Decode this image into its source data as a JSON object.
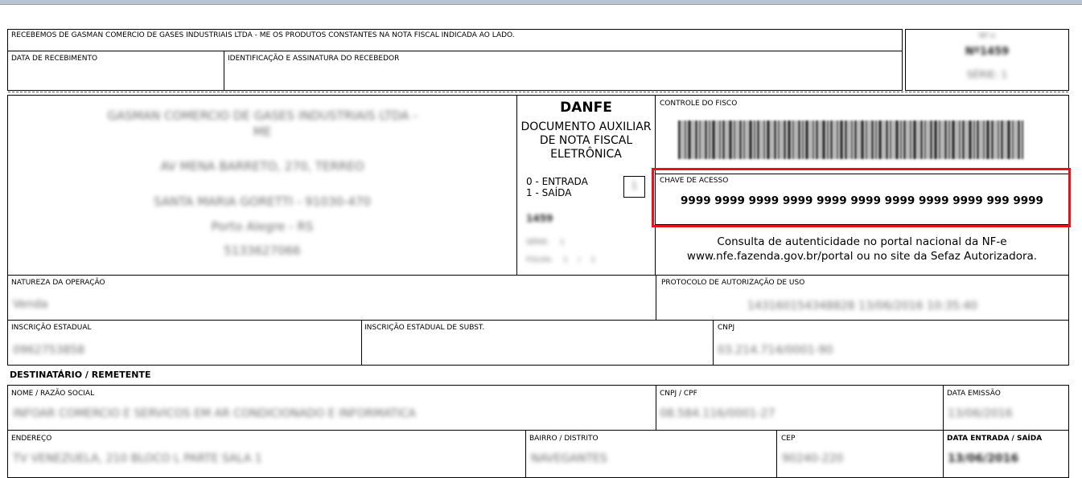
{
  "receipt": {
    "header": "RECEBEMOS DE GASMAN COMERCIO DE GASES INDUSTRIAIS LTDA - ME OS PRODUTOS CONSTANTES NA NOTA FISCAL INDICADA AO LADO.",
    "date_label": "DATA DE RECEBIMENTO",
    "signature_label": "IDENTIFICAÇÃO E ASSINATURA DO RECEBEDOR",
    "nfe_label": "NF-e",
    "nfe_number": "Nº1459",
    "nfe_series": "SÉRIE: 1"
  },
  "emitter": {
    "name_line1": "GASMAN COMERCIO DE GASES INDUSTRIAIS LTDA -",
    "name_line2": "ME",
    "address": "AV MENA BARRETO, 270, TERREO",
    "district": "SANTA MARIA GORETTI - 91030-470",
    "city": "Porto Alegre - RS",
    "phone": "5133627066"
  },
  "danfe": {
    "title": "DANFE",
    "subtitle_line1": "DOCUMENTO AUXILIAR",
    "subtitle_line2": "DE NOTA FISCAL",
    "subtitle_line3": "ELETRÔNICA",
    "entry_label": "0 - ENTRADA",
    "exit_label": "1 - SAÍDA",
    "type_value": "1",
    "number": "1459",
    "series": "SÉRIE: 1",
    "page": "FOLHA: 1 / 1"
  },
  "fiscal": {
    "control_label": "CONTROLE DO FISCO",
    "barcode_icon": "barcode",
    "access_key_label": "CHAVE DE ACESSO",
    "access_key": "9999 9999 9999 9999 9999 9999 9999 9999 9999 999 9999",
    "highlight_color": "#e8121b",
    "consult_line1": "Consulta de autenticidade no portal nacional da NF-e",
    "consult_line2": "www.nfe.fazenda.gov.br/portal ou no site da Sefaz Autorizadora."
  },
  "operation": {
    "nature_label": "NATUREZA DA OPERAÇÃO",
    "nature_value": "Venda",
    "protocol_label": "PROTOCOLO DE AUTORIZAÇÃO DE USO",
    "protocol_value": "143160154348828 13/06/2016 10:35:40"
  },
  "registration": {
    "ie_label": "INSCRIÇÃO ESTADUAL",
    "ie_value": "0962753858",
    "ie_subst_label": "INSCRIÇÃO ESTADUAL DE SUBST.",
    "cnpj_label": "CNPJ",
    "cnpj_value": "03.214.714/0001-90"
  },
  "recipient": {
    "section_title": "DESTINATÁRIO / REMETENTE",
    "name_label": "NOME / RAZÃO SOCIAL",
    "name_value": "INFOAR COMERCIO E SERVICOS EM AR CONDICIONADO E INFORMATICA",
    "cnpj_label": "CNPJ / CPF",
    "cnpj_value": "08.584.116/0001-27",
    "emission_label": "DATA EMISSÃO",
    "emission_value": "13/06/2016",
    "address_label": "ENDEREÇO",
    "address_value": "TV VENEZUELA, 210 BLOCO L PARTE SALA 1",
    "district_label": "BAIRRO / DISTRITO",
    "district_value": "NAVEGANTES",
    "cep_label": "CEP",
    "cep_value": "90240-220",
    "entry_exit_label": "DATA ENTRADA / SAÍDA",
    "entry_exit_value": "13/06/2016"
  }
}
